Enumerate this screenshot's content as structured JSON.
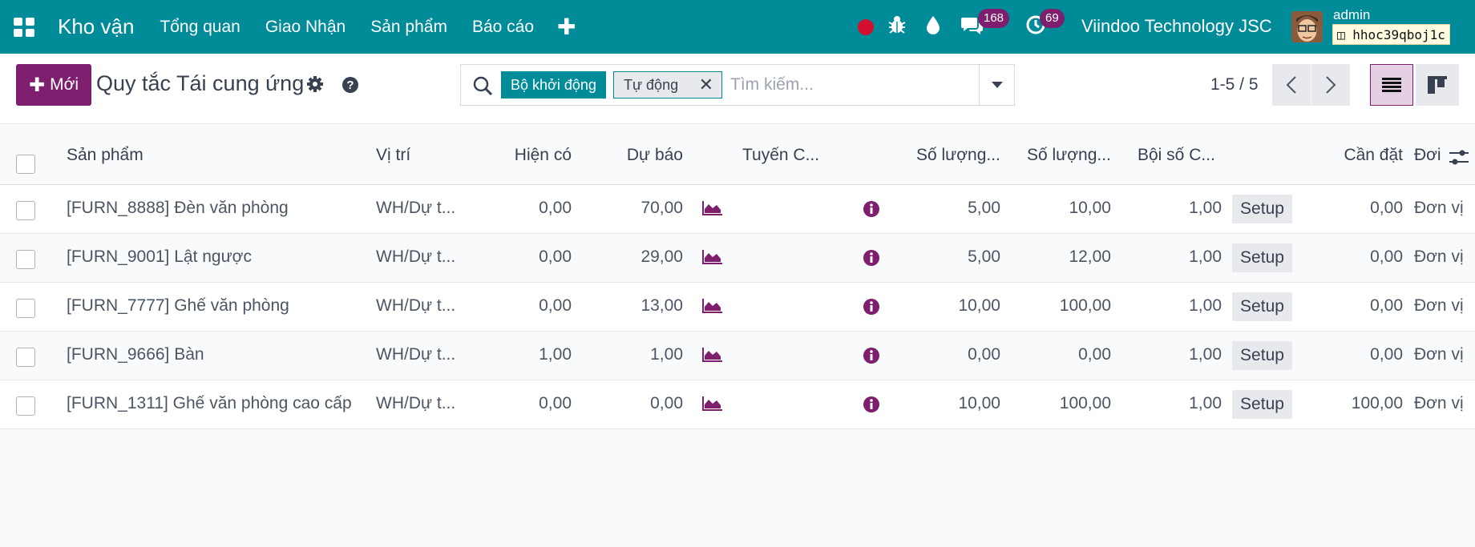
{
  "navbar": {
    "app_name": "Kho vận",
    "menu": [
      "Tổng quan",
      "Giao Nhận",
      "Sản phẩm",
      "Báo cáo"
    ],
    "add_menu_icon": "plus-icon",
    "chat_badge": "168",
    "activity_badge": "69",
    "company": "Viindoo Technology JSC",
    "user": "admin",
    "database": "hhoc39qboj1c",
    "colors": {
      "bar": "#008b99",
      "badge": "#7d1e6f",
      "record": "#d20f2f"
    }
  },
  "control": {
    "new_button": "Mới",
    "title": "Quy tắc Tái cung ứng",
    "search": {
      "facet_label": "Bộ khởi động",
      "facet_value": "Tự động",
      "placeholder": "Tìm kiếm..."
    },
    "pager": "1-5 / 5"
  },
  "table": {
    "columns": [
      "Sản phẩm",
      "Vị trí",
      "Hiện có",
      "Dự báo",
      "Tuyến C...",
      "Số lượng...",
      "Số lượng...",
      "Bội số C...",
      "Cần đặt",
      "Đơi"
    ],
    "setup_label": "Setup",
    "rows": [
      {
        "product": "[FURN_8888] Đèn văn phòng",
        "location": "WH/Dự t...",
        "on_hand": "0,00",
        "forecast": "70,00",
        "min": "5,00",
        "max": "10,00",
        "multiple": "1,00",
        "to_order": "0,00",
        "uom": "Đơn vị"
      },
      {
        "product": "[FURN_9001] Lật ngược",
        "location": "WH/Dự t...",
        "on_hand": "0,00",
        "forecast": "29,00",
        "min": "5,00",
        "max": "12,00",
        "multiple": "1,00",
        "to_order": "0,00",
        "uom": "Đơn vị"
      },
      {
        "product": "[FURN_7777] Ghế văn phòng",
        "location": "WH/Dự t...",
        "on_hand": "0,00",
        "forecast": "13,00",
        "min": "10,00",
        "max": "100,00",
        "multiple": "1,00",
        "to_order": "0,00",
        "uom": "Đơn vị"
      },
      {
        "product": "[FURN_9666] Bàn",
        "location": "WH/Dự t...",
        "on_hand": "1,00",
        "forecast": "1,00",
        "min": "0,00",
        "max": "0,00",
        "multiple": "1,00",
        "to_order": "0,00",
        "uom": "Đơn vị"
      },
      {
        "product": "[FURN_1311] Ghế văn phòng cao cấp",
        "location": "WH/Dự t...",
        "on_hand": "0,00",
        "forecast": "0,00",
        "min": "10,00",
        "max": "100,00",
        "multiple": "1,00",
        "to_order": "100,00",
        "uom": "Đơn vị"
      }
    ]
  }
}
